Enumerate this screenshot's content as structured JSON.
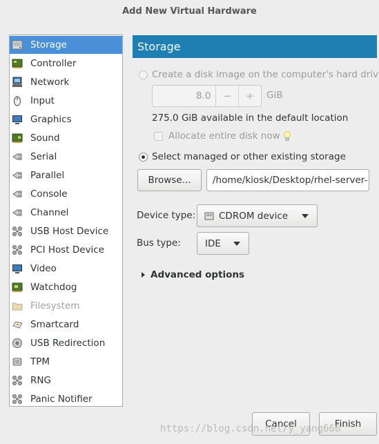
{
  "window": {
    "title": "Add New Virtual Hardware"
  },
  "sidebar": {
    "items": [
      {
        "label": "Storage",
        "icon": "storage-icon",
        "selected": true
      },
      {
        "label": "Controller",
        "icon": "controller-icon"
      },
      {
        "label": "Network",
        "icon": "network-icon"
      },
      {
        "label": "Input",
        "icon": "mouse-icon"
      },
      {
        "label": "Graphics",
        "icon": "monitor-icon"
      },
      {
        "label": "Sound",
        "icon": "sound-card-icon"
      },
      {
        "label": "Serial",
        "icon": "serial-plug-icon"
      },
      {
        "label": "Parallel",
        "icon": "parallel-plug-icon"
      },
      {
        "label": "Console",
        "icon": "console-plug-icon"
      },
      {
        "label": "Channel",
        "icon": "channel-plug-icon"
      },
      {
        "label": "USB Host Device",
        "icon": "usb-device-icon"
      },
      {
        "label": "PCI Host Device",
        "icon": "pci-device-icon"
      },
      {
        "label": "Video",
        "icon": "video-monitor-icon"
      },
      {
        "label": "Watchdog",
        "icon": "watchdog-icon"
      },
      {
        "label": "Filesystem",
        "icon": "folder-icon",
        "disabled": true
      },
      {
        "label": "Smartcard",
        "icon": "smartcard-icon"
      },
      {
        "label": "USB Redirection",
        "icon": "usb-redirection-icon"
      },
      {
        "label": "TPM",
        "icon": "tpm-chip-icon"
      },
      {
        "label": "RNG",
        "icon": "rng-icon"
      },
      {
        "label": "Panic Notifier",
        "icon": "panic-notifier-icon"
      }
    ]
  },
  "main": {
    "header": "Storage",
    "create_disk_label": "Create a disk image on the computer's hard drive",
    "disk_size_value": "8.0",
    "spin_minus": "−",
    "spin_plus": "+",
    "disk_size_unit": "GiB",
    "available_text": "275.0 GiB available in the default location",
    "allocate_label": "Allocate entire disk now",
    "select_storage_label": "Select managed or other existing storage",
    "browse_label": "Browse...",
    "path_value": "/home/kiosk/Desktop/rhel-server-",
    "device_type_label": "Device type:",
    "device_type_value": "CDROM device",
    "bus_type_label": "Bus type:",
    "bus_type_value": "IDE",
    "advanced_label": "Advanced options"
  },
  "footer": {
    "cancel_label": "Cancel",
    "finish_label": "Finish"
  },
  "watermark": "https://blog.csdn.net/y_yang666",
  "colors": {
    "accent": "#4a90d9",
    "header": "#1f7fb3",
    "background": "#ededed"
  }
}
